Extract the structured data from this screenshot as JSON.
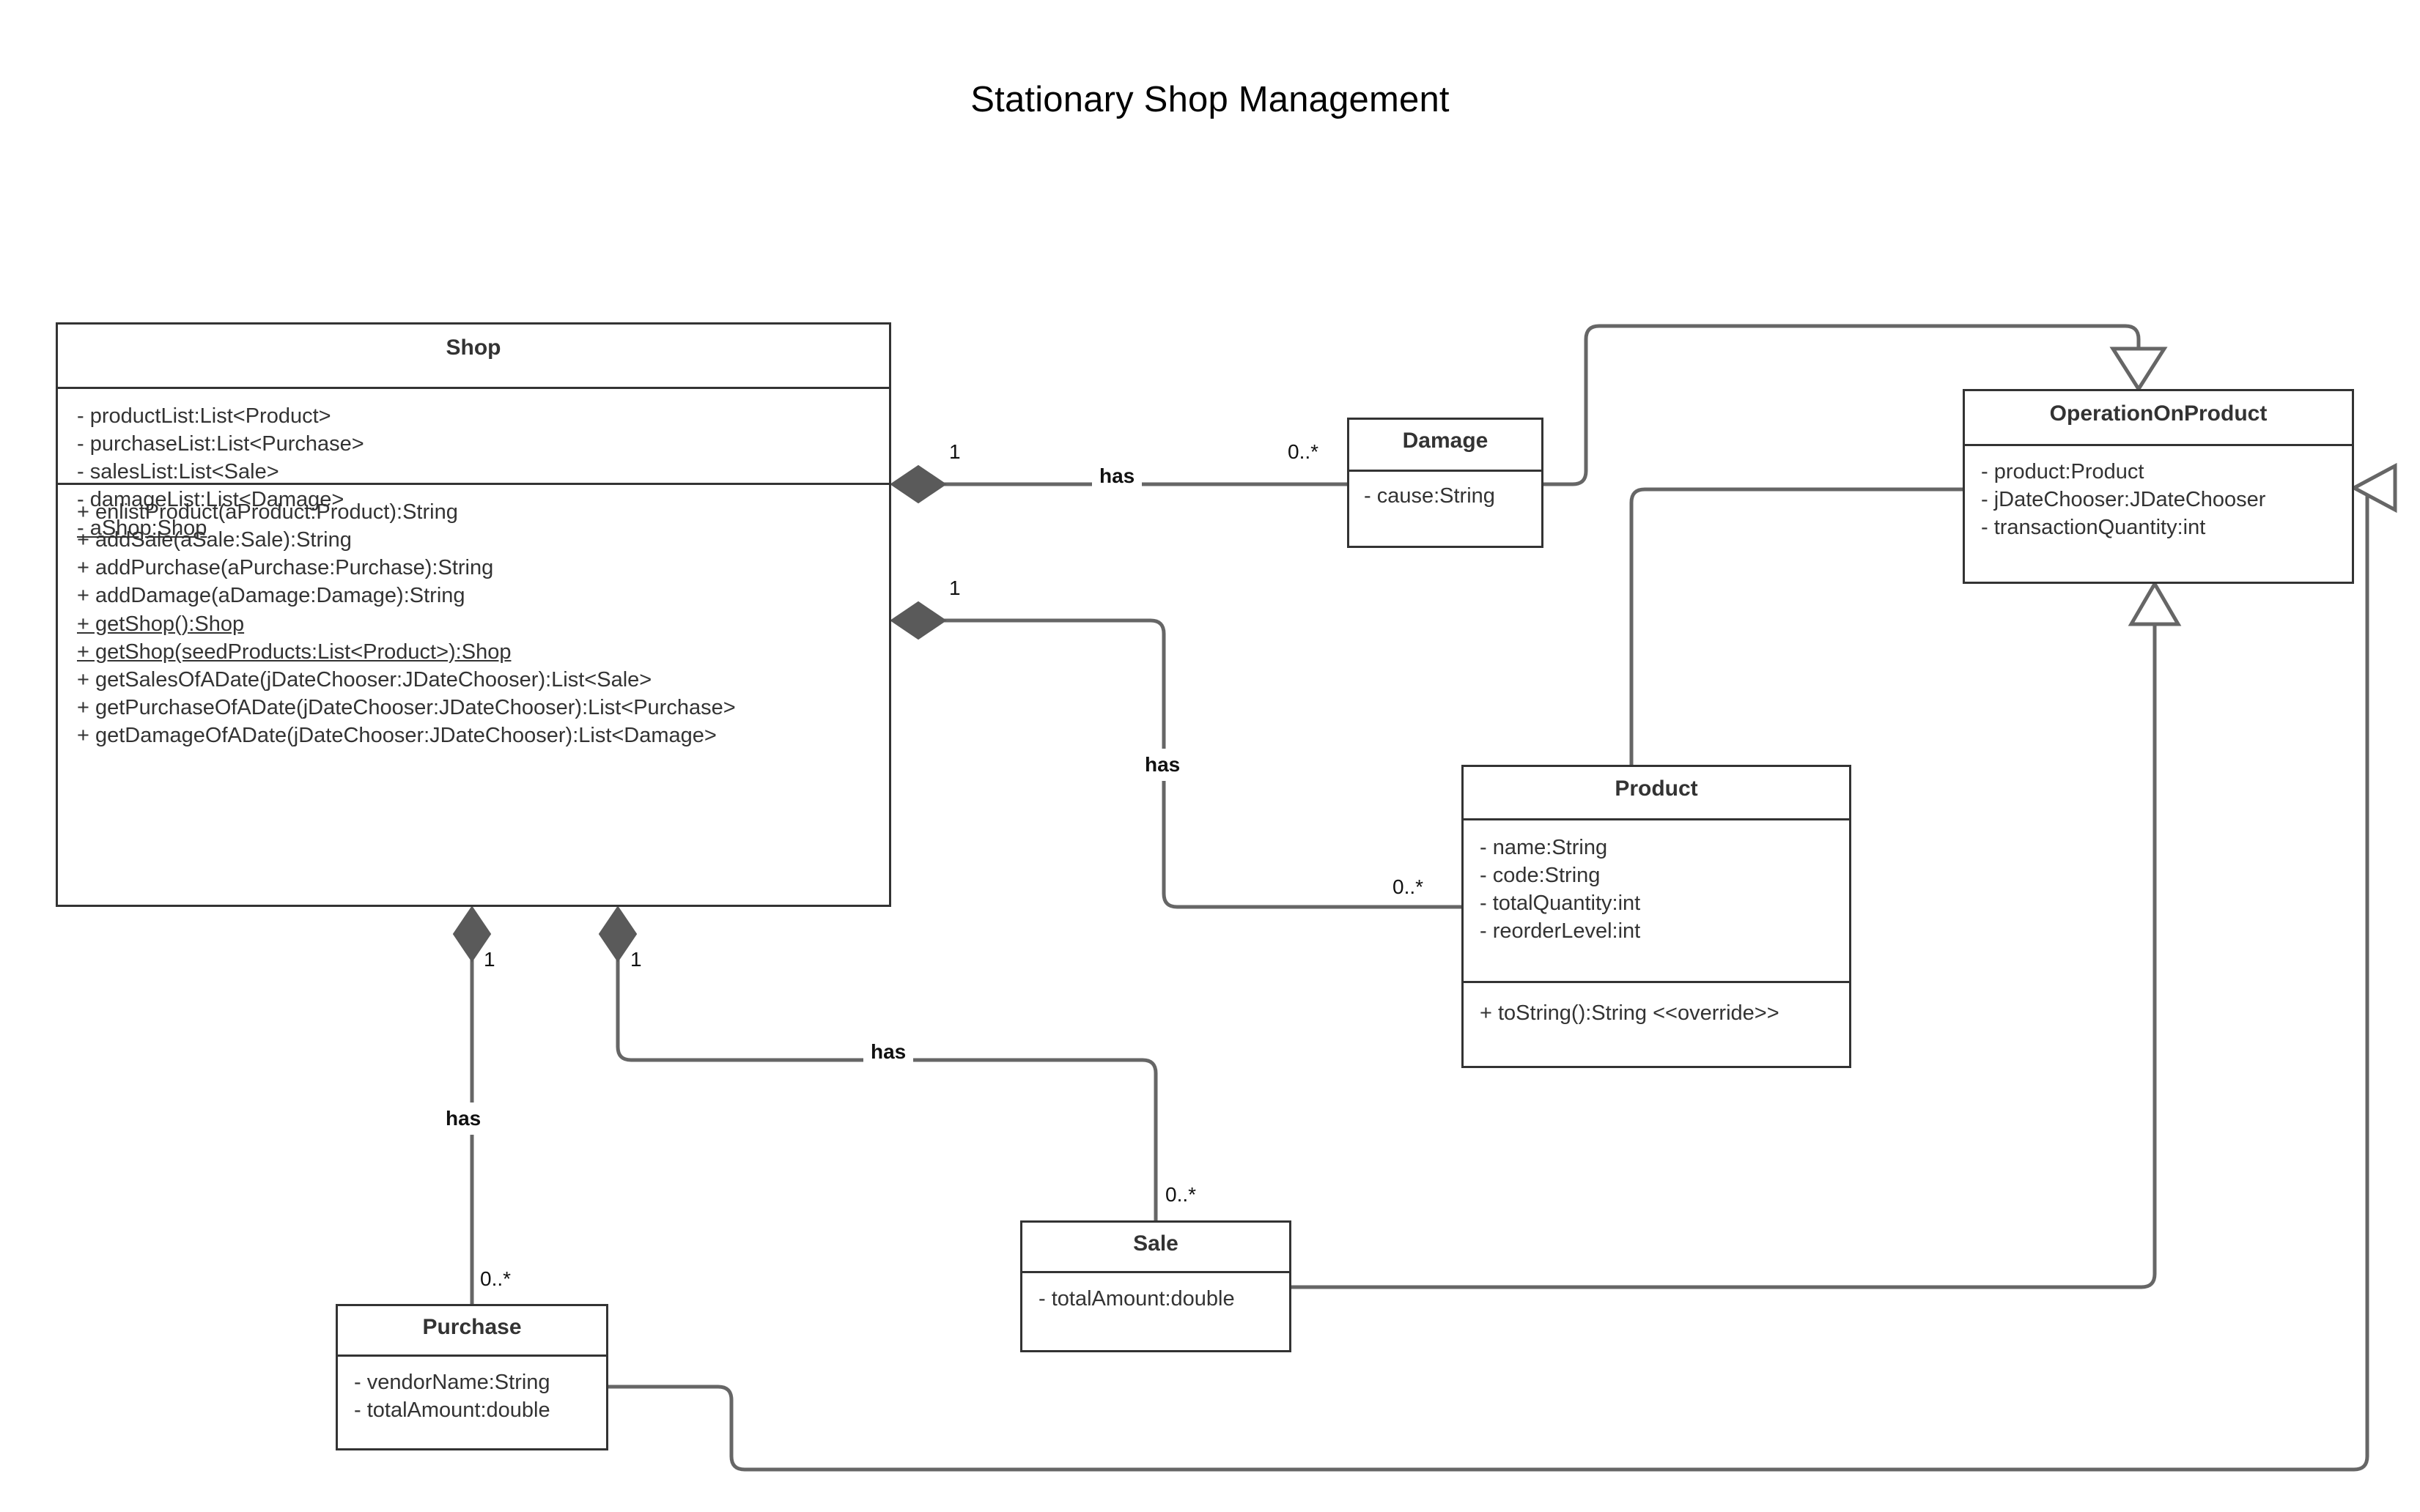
{
  "title": "Stationary Shop Management",
  "colors": {
    "box_border": "#333333",
    "connector": "#666666",
    "diamond_fill": "#5a5a5a",
    "text": "#333333",
    "title_text": "#000000",
    "background": "#ffffff"
  },
  "classes": {
    "shop": {
      "name": "Shop",
      "attributes": [
        {
          "text": "- productList:List<Product>",
          "static": false
        },
        {
          "text": "- purchaseList:List<Purchase>",
          "static": false
        },
        {
          "text": "- salesList:List<Sale>",
          "static": false
        },
        {
          "text": "- damageList:List<Damage>",
          "static": false
        },
        {
          "text": "- aShop:Shop",
          "static": true
        }
      ],
      "operations": [
        {
          "text": "+ enlistProduct(aProduct:Product):String",
          "static": false
        },
        {
          "text": "+ addSale(aSale:Sale):String",
          "static": false
        },
        {
          "text": "+ addPurchase(aPurchase:Purchase):String",
          "static": false
        },
        {
          "text": "+ addDamage(aDamage:Damage):String",
          "static": false
        },
        {
          "text": "+ getShop():Shop",
          "static": true
        },
        {
          "text": "+ getShop(seedProducts:List<Product>):Shop",
          "static": true
        },
        {
          "text": "+ getSalesOfADate(jDateChooser:JDateChooser):List<Sale>",
          "static": false
        },
        {
          "text": "+ getPurchaseOfADate(jDateChooser:JDateChooser):List<Purchase>",
          "static": false
        },
        {
          "text": "+ getDamageOfADate(jDateChooser:JDateChooser):List<Damage>",
          "static": false
        }
      ]
    },
    "damage": {
      "name": "Damage",
      "attributes": [
        {
          "text": "- cause:String",
          "static": false
        }
      ],
      "operations": []
    },
    "operation_on_product": {
      "name": "OperationOnProduct",
      "attributes": [
        {
          "text": "- product:Product",
          "static": false
        },
        {
          "text": "- jDateChooser:JDateChooser",
          "static": false
        },
        {
          "text": "- transactionQuantity:int",
          "static": false
        }
      ],
      "operations": []
    },
    "product": {
      "name": "Product",
      "attributes": [
        {
          "text": "- name:String",
          "static": false
        },
        {
          "text": "- code:String",
          "static": false
        },
        {
          "text": "- totalQuantity:int",
          "static": false
        },
        {
          "text": "- reorderLevel:int",
          "static": false
        }
      ],
      "operations": [
        {
          "text": "+ toString():String <<override>>",
          "static": false
        }
      ]
    },
    "sale": {
      "name": "Sale",
      "attributes": [
        {
          "text": "- totalAmount:double",
          "static": false
        }
      ],
      "operations": []
    },
    "purchase": {
      "name": "Purchase",
      "attributes": [
        {
          "text": "- vendorName:String",
          "static": false
        },
        {
          "text": "- totalAmount:double",
          "static": false
        }
      ],
      "operations": []
    }
  },
  "relationships": [
    {
      "id": "shop-damage",
      "kind": "composition",
      "from": "Shop",
      "to": "Damage",
      "label": "has",
      "source_multiplicity": "1",
      "target_multiplicity": "0..*"
    },
    {
      "id": "shop-product",
      "kind": "composition",
      "from": "Shop",
      "to": "Product",
      "label": "has",
      "source_multiplicity": "1",
      "target_multiplicity": "0..*"
    },
    {
      "id": "shop-purchase",
      "kind": "composition",
      "from": "Shop",
      "to": "Purchase",
      "label": "has",
      "source_multiplicity": "1",
      "target_multiplicity": "0..*"
    },
    {
      "id": "shop-sale",
      "kind": "composition",
      "from": "Shop",
      "to": "Sale",
      "label": "has",
      "source_multiplicity": "1",
      "target_multiplicity": "0..*"
    },
    {
      "id": "damage-oop",
      "kind": "generalization",
      "from": "Damage",
      "to": "OperationOnProduct",
      "label": "",
      "source_multiplicity": "",
      "target_multiplicity": ""
    },
    {
      "id": "sale-oop",
      "kind": "generalization",
      "from": "Sale",
      "to": "OperationOnProduct",
      "label": "",
      "source_multiplicity": "",
      "target_multiplicity": ""
    },
    {
      "id": "purchase-oop",
      "kind": "generalization",
      "from": "Purchase",
      "to": "OperationOnProduct",
      "label": "",
      "source_multiplicity": "",
      "target_multiplicity": ""
    },
    {
      "id": "product-oop",
      "kind": "association",
      "from": "Product",
      "to": "OperationOnProduct",
      "label": "",
      "source_multiplicity": "",
      "target_multiplicity": ""
    }
  ],
  "edge_labels": {
    "shop_damage_src": "1",
    "shop_damage_label": "has",
    "shop_damage_tgt": "0..*",
    "shop_product_src": "1",
    "shop_product_label": "has",
    "shop_product_tgt": "0..*",
    "shop_purchase_src": "1",
    "shop_purchase_label": "has",
    "shop_purchase_tgt": "0..*",
    "shop_sale_src": "1",
    "shop_sale_label": "has",
    "shop_sale_tgt": "0..*"
  }
}
